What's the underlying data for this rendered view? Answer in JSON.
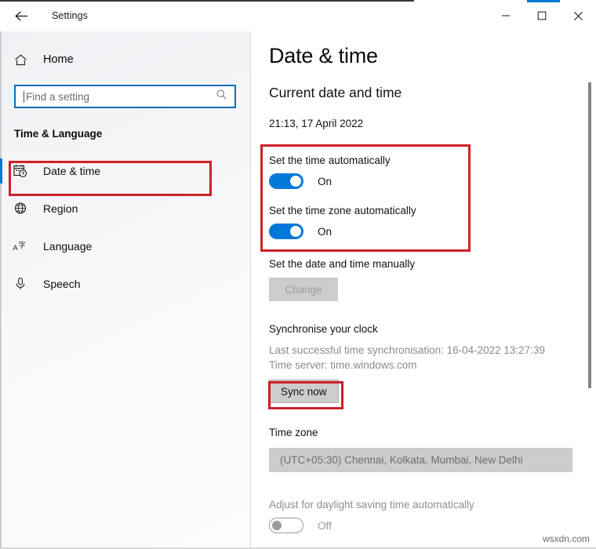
{
  "window": {
    "app_title": "Settings",
    "back_icon": "back-arrow-icon",
    "minimize_icon": "minimize-icon",
    "maximize_icon": "maximize-icon",
    "close_icon": "close-icon",
    "accent_color": "#0078d7"
  },
  "sidebar": {
    "home": {
      "label": "Home",
      "icon": "home-icon"
    },
    "search": {
      "placeholder": "Find a setting",
      "icon": "search-icon",
      "value": ""
    },
    "section_title": "Time & Language",
    "items": [
      {
        "label": "Date & time",
        "icon": "calendar-clock-icon",
        "selected": true
      },
      {
        "label": "Region",
        "icon": "globe-icon",
        "selected": false
      },
      {
        "label": "Language",
        "icon": "language-icon",
        "selected": false
      },
      {
        "label": "Speech",
        "icon": "microphone-icon",
        "selected": false
      }
    ]
  },
  "main": {
    "page_title": "Date & time",
    "current_section_heading": "Current date and time",
    "current_datetime": "21:13, 17 April 2022",
    "set_time_auto": {
      "label": "Set the time automatically",
      "state": "On",
      "on": true
    },
    "set_timezone_auto": {
      "label": "Set the time zone automatically",
      "state": "On",
      "on": true
    },
    "manual": {
      "label": "Set the date and time manually",
      "button_label": "Change",
      "disabled": true
    },
    "sync": {
      "heading": "Synchronise your clock",
      "last_sync": "Last successful time synchronisation: 16-04-2022 13:27:39",
      "time_server": "Time server: time.windows.com",
      "button_label": "Sync now"
    },
    "timezone": {
      "heading": "Time zone",
      "selected": "(UTC+05:30) Chennai, Kolkata, Mumbai, New Delhi"
    },
    "dst": {
      "label": "Adjust for daylight saving time automatically",
      "state": "Off",
      "on": false
    }
  },
  "annotations": {
    "highlight_color": "#cc2229",
    "boxes": [
      "date-time-nav-item",
      "auto-time-toggles",
      "sync-now-button"
    ]
  },
  "watermark": "wsxdn.com"
}
